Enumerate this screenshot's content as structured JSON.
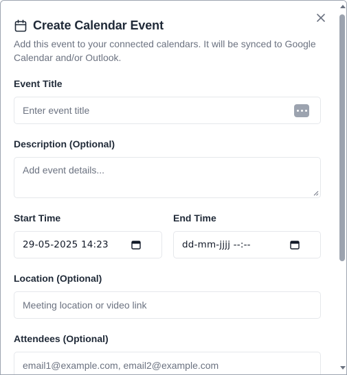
{
  "dialog": {
    "title": "Create Calendar Event",
    "subtitle": "Add this event to your connected calendars. It will be synced to Google Calendar and/or Outlook.",
    "icon": "calendar-icon",
    "close_icon": "close-icon"
  },
  "fields": {
    "event_title": {
      "label": "Event Title",
      "placeholder": "Enter event title"
    },
    "description": {
      "label": "Description (Optional)",
      "placeholder": "Add event details..."
    },
    "start_time": {
      "label": "Start Time",
      "value": "29-05-2025 14:23"
    },
    "end_time": {
      "label": "End Time",
      "value": "dd-mm-jjjj --:--"
    },
    "location": {
      "label": "Location (Optional)",
      "placeholder": "Meeting location or video link"
    },
    "attendees": {
      "label": "Attendees (Optional)",
      "placeholder": "email1@example.com, email2@example.com"
    }
  },
  "colors": {
    "accent": "#1f2937",
    "muted": "#6b7280",
    "border": "#e5e7eb"
  }
}
